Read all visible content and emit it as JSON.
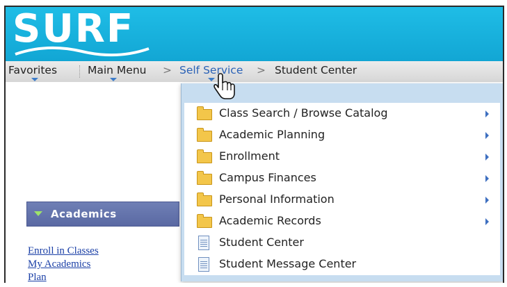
{
  "banner": {
    "logo_text": "SURF",
    "color": "#12a6d4"
  },
  "navbar": {
    "favorites": "Favorites",
    "main_menu": "Main Menu",
    "separator": ">",
    "self_service": "Self Service",
    "student_center": "Student Center"
  },
  "dropdown": {
    "items": [
      {
        "label": "Class Search / Browse Catalog",
        "icon": "folder-icon",
        "has_submenu": true
      },
      {
        "label": "Academic Planning",
        "icon": "folder-icon",
        "has_submenu": true
      },
      {
        "label": "Enrollment",
        "icon": "folder-icon",
        "has_submenu": true
      },
      {
        "label": "Campus Finances",
        "icon": "folder-icon",
        "has_submenu": true
      },
      {
        "label": "Personal Information",
        "icon": "folder-icon",
        "has_submenu": true
      },
      {
        "label": "Academic Records",
        "icon": "folder-icon",
        "has_submenu": true
      },
      {
        "label": "Student Center",
        "icon": "document-icon",
        "has_submenu": false
      },
      {
        "label": "Student Message Center",
        "icon": "document-icon",
        "has_submenu": false
      }
    ]
  },
  "academics": {
    "title": "Academics",
    "links": [
      "Enroll in Classes",
      "My Academics",
      "Plan"
    ]
  }
}
